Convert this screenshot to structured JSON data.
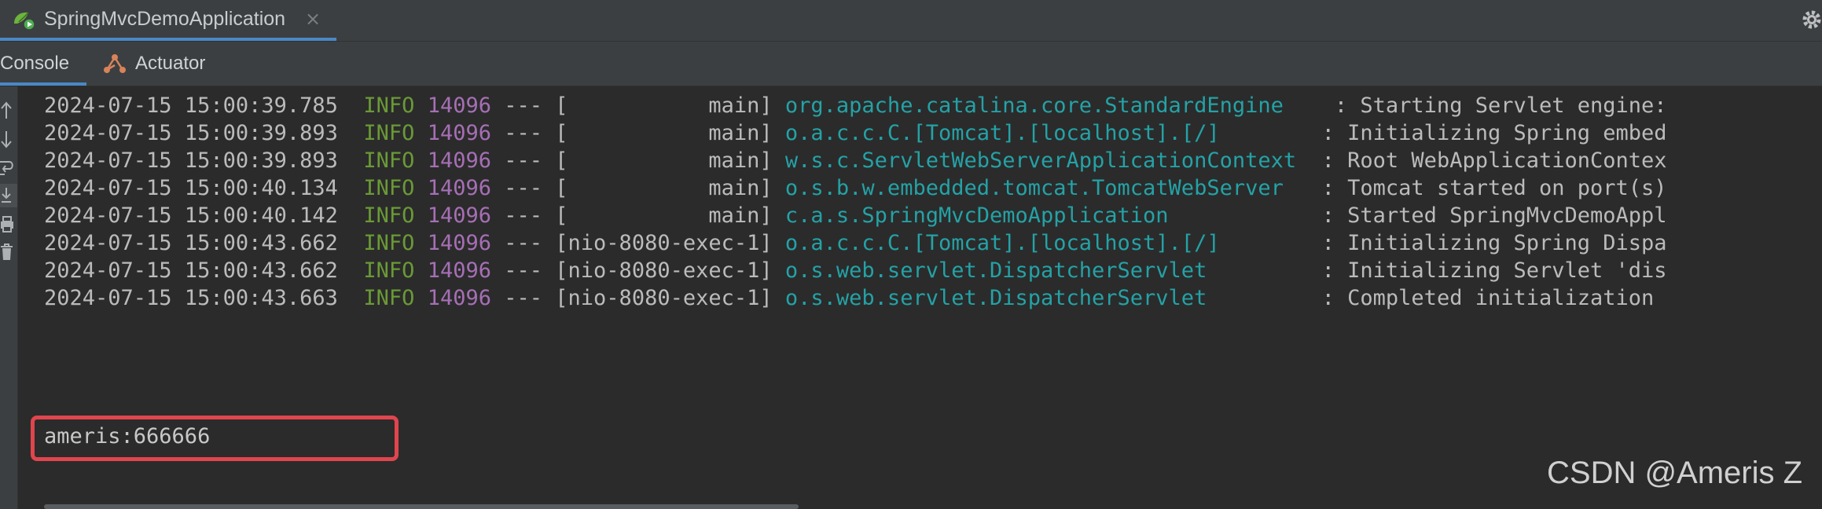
{
  "run_tab": {
    "title": "SpringMvcDemoApplication",
    "close_glyph": "×"
  },
  "sub_tabs": [
    {
      "label": "Console",
      "active": true
    },
    {
      "label": "Actuator",
      "icon": "actuator-icon",
      "active": false
    }
  ],
  "toolbar_icons": [
    "up-arrow-icon",
    "down-arrow-icon",
    "soft-wrap-icon",
    "scroll-to-end-icon",
    "print-icon",
    "trash-icon"
  ],
  "colors": {
    "info": "#6a9a36",
    "pid": "#a66fb5",
    "logger": "#24a2a6",
    "highlight": "#e0454e",
    "accent": "#4a88c7"
  },
  "log_lines": [
    {
      "timestamp": "2024-07-15 15:00:39.785",
      "level": "INFO",
      "pid": "14096",
      "sep": "---",
      "thread": "[           main]",
      "logger": "org.apache.catalina.core.StandardEngine   ",
      "message": ": Starting Servlet engine: "
    },
    {
      "timestamp": "2024-07-15 15:00:39.893",
      "level": "INFO",
      "pid": "14096",
      "sep": "---",
      "thread": "[           main]",
      "logger": "o.a.c.c.C.[Tomcat].[localhost].[/]       ",
      "message": ": Initializing Spring embed"
    },
    {
      "timestamp": "2024-07-15 15:00:39.893",
      "level": "INFO",
      "pid": "14096",
      "sep": "---",
      "thread": "[           main]",
      "logger": "w.s.c.ServletWebServerApplicationContext ",
      "message": ": Root WebApplicationContex"
    },
    {
      "timestamp": "2024-07-15 15:00:40.134",
      "level": "INFO",
      "pid": "14096",
      "sep": "---",
      "thread": "[           main]",
      "logger": "o.s.b.w.embedded.tomcat.TomcatWebServer  ",
      "message": ": Tomcat started on port(s)"
    },
    {
      "timestamp": "2024-07-15 15:00:40.142",
      "level": "INFO",
      "pid": "14096",
      "sep": "---",
      "thread": "[           main]",
      "logger": "c.a.s.SpringMvcDemoApplication           ",
      "message": ": Started SpringMvcDemoAppl"
    },
    {
      "timestamp": "2024-07-15 15:00:43.662",
      "level": "INFO",
      "pid": "14096",
      "sep": "---",
      "thread": "[nio-8080-exec-1]",
      "logger": "o.a.c.c.C.[Tomcat].[localhost].[/]       ",
      "message": ": Initializing Spring Dispa"
    },
    {
      "timestamp": "2024-07-15 15:00:43.662",
      "level": "INFO",
      "pid": "14096",
      "sep": "---",
      "thread": "[nio-8080-exec-1]",
      "logger": "o.s.web.servlet.DispatcherServlet        ",
      "message": ": Initializing Servlet 'dis"
    },
    {
      "timestamp": "2024-07-15 15:00:43.663",
      "level": "INFO",
      "pid": "14096",
      "sep": "---",
      "thread": "[nio-8080-exec-1]",
      "logger": "o.s.web.servlet.DispatcherServlet        ",
      "message": ": Completed initialization "
    }
  ],
  "output_line": "ameris:666666",
  "watermark": "CSDN @Ameris Z"
}
